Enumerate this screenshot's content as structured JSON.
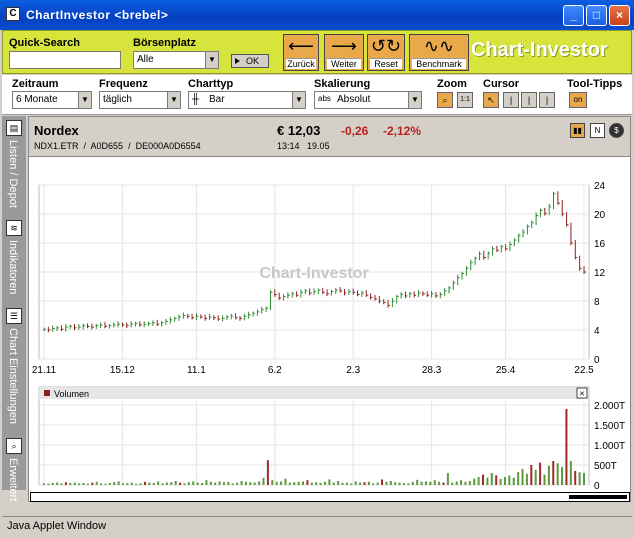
{
  "window": {
    "title": "ChartInvestor  <brebel>",
    "icon": "chart-app-icon"
  },
  "toolbar": {
    "quick_search_label": "Quick-Search",
    "quick_search_value": "",
    "exchange_label": "Börsenplatz",
    "exchange_value": "Alle",
    "ok_label": "OK",
    "back_label": "Zurück",
    "forward_label": "Weiter",
    "reset_label": "Reset",
    "benchmark_label": "Benchmark",
    "brand": "Chart-Investor"
  },
  "controls": {
    "zeitraum_label": "Zeitraum",
    "zeitraum_value": "6 Monate",
    "frequenz_label": "Frequenz",
    "frequenz_value": "täglich",
    "charttyp_label": "Charttyp",
    "charttyp_value": "Bar",
    "skalierung_label": "Skalierung",
    "skalierung_value": "Absolut",
    "zoom_label": "Zoom",
    "zoom_reset": "1:1",
    "cursor_label": "Cursor",
    "tooltips_label": "Tool-Tipps",
    "tooltips_value": "on"
  },
  "sidebar": {
    "items": [
      {
        "label": "Listen / Depot"
      },
      {
        "label": "Indikatoren"
      },
      {
        "label": "Chart Einstellungen"
      },
      {
        "label": "Erweitert"
      }
    ]
  },
  "quote": {
    "name": "Nordex",
    "symbol": "NDX1.ETR",
    "wkn": "A0D655",
    "isin": "DE000A0D6554",
    "price": "€ 12,03",
    "change": "-0,26",
    "change_pct": "-2,12%",
    "time": "13:14",
    "date": "19.05"
  },
  "chart": {
    "watermark": "Chart-Investor",
    "volume_label": "Volumen",
    "volume_close": "×"
  },
  "chart_data": {
    "type": "bar",
    "price": {
      "x_ticks": [
        "21.11",
        "15.12",
        "11.1",
        "6.2",
        "2.3",
        "28.3",
        "25.4",
        "22.5"
      ],
      "y_ticks": [
        "0",
        "4",
        "8",
        "12",
        "16",
        "20",
        "24"
      ],
      "ylim": [
        0,
        24
      ],
      "close": [
        4.1,
        4.0,
        4.2,
        4.3,
        4.1,
        4.4,
        4.5,
        4.3,
        4.4,
        4.6,
        4.5,
        4.4,
        4.6,
        4.7,
        4.5,
        4.6,
        4.7,
        4.8,
        4.7,
        4.6,
        4.8,
        4.9,
        4.7,
        4.8,
        4.9,
        5.0,
        4.8,
        5.0,
        5.2,
        5.4,
        5.6,
        5.8,
        6.0,
        5.9,
        5.7,
        5.9,
        5.8,
        5.6,
        5.8,
        5.7,
        5.5,
        5.6,
        5.8,
        5.9,
        5.7,
        5.6,
        5.9,
        6.1,
        6.3,
        6.5,
        6.8,
        7.0,
        9.2,
        8.9,
        8.4,
        8.6,
        8.8,
        9.0,
        8.8,
        9.2,
        9.4,
        9.1,
        9.3,
        9.5,
        9.2,
        9.0,
        9.3,
        9.5,
        9.4,
        9.1,
        9.3,
        9.2,
        8.9,
        9.1,
        8.8,
        8.5,
        8.3,
        8.0,
        7.8,
        7.4,
        8.0,
        8.6,
        8.9,
        8.7,
        9.0,
        8.8,
        9.1,
        9.0,
        8.8,
        9.0,
        8.7,
        8.9,
        9.4,
        9.8,
        10.5,
        11.2,
        11.8,
        12.5,
        13.3,
        13.9,
        14.5,
        14.0,
        14.6,
        15.2,
        15.0,
        15.5,
        15.2,
        15.8,
        16.4,
        17.0,
        17.5,
        18.3,
        18.8,
        19.8,
        20.5,
        20.1,
        21.0,
        22.8,
        21.5,
        20.0,
        18.5,
        16.0,
        14.0,
        12.5,
        12.0
      ],
      "last_label": "12"
    },
    "volume": {
      "y_ticks": [
        "0",
        "500T",
        "1.000T",
        "1.500T",
        "2.000T"
      ],
      "ylim": [
        0,
        2100
      ],
      "values": [
        40,
        30,
        50,
        60,
        40,
        70,
        50,
        60,
        40,
        50,
        30,
        60,
        80,
        40,
        30,
        50,
        70,
        90,
        40,
        50,
        60,
        30,
        40,
        80,
        60,
        50,
        90,
        40,
        60,
        70,
        100,
        60,
        40,
        70,
        90,
        60,
        50,
        120,
        80,
        60,
        90,
        70,
        80,
        40,
        60,
        100,
        80,
        70,
        60,
        90,
        180,
        620,
        120,
        80,
        90,
        160,
        60,
        70,
        80,
        90,
        120,
        60,
        70,
        50,
        80,
        140,
        60,
        100,
        50,
        60,
        40,
        90,
        60,
        70,
        80,
        40,
        60,
        140,
        80,
        100,
        70,
        60,
        50,
        40,
        80,
        130,
        80,
        90,
        80,
        120,
        80,
        60,
        300,
        60,
        90,
        120,
        80,
        100,
        160,
        200,
        260,
        180,
        300,
        240,
        150,
        200,
        240,
        180,
        320,
        400,
        280,
        500,
        380,
        560,
        260,
        480,
        600,
        540,
        450,
        1900,
        600,
        350,
        320,
        300
      ],
      "red_indices": [
        5,
        11,
        23,
        31,
        51,
        60,
        73,
        77,
        91,
        100,
        103,
        111,
        113,
        116,
        119,
        121
      ]
    }
  }
}
